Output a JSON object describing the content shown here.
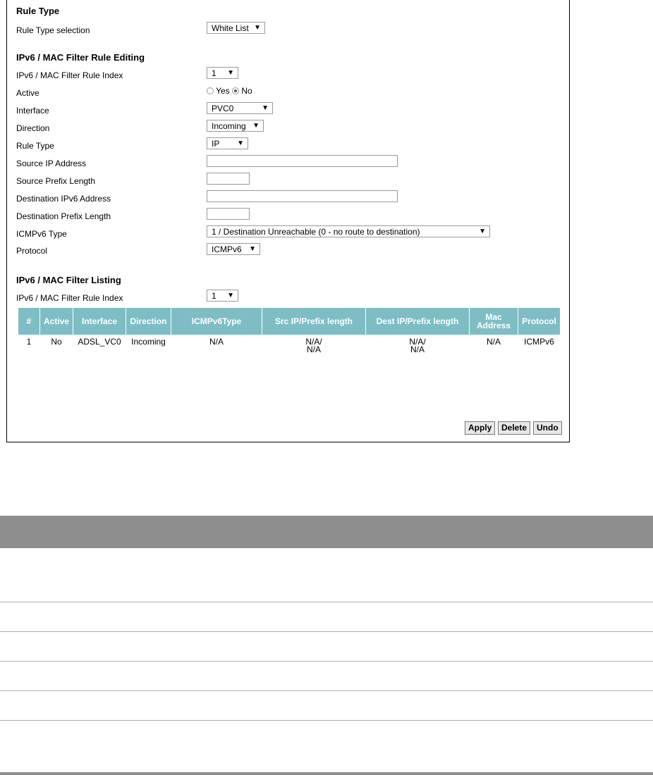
{
  "rule_type_section": {
    "title": "Rule Type",
    "selection_label": "Rule Type selection",
    "selection_value": "White List"
  },
  "editing": {
    "title": "IPv6 / MAC Filter Rule Editing",
    "rule_index_label": "IPv6 / MAC Filter Rule Index",
    "rule_index_value": "1",
    "active_label": "Active",
    "active_yes": "Yes",
    "active_no": "No",
    "interface_label": "Interface",
    "interface_value": "PVC0",
    "direction_label": "Direction",
    "direction_value": "Incoming",
    "rule_type_label": "Rule Type",
    "rule_type_value": "IP",
    "source_ip_label": "Source IP Address",
    "source_ip_value": "",
    "source_prefix_label": "Source Prefix Length",
    "source_prefix_value": "",
    "dest_ip_label": "Destination IPv6 Address",
    "dest_ip_value": "",
    "dest_prefix_label": "Destination Prefix Length",
    "dest_prefix_value": "",
    "icmp_label": "ICMPv6 Type",
    "icmp_value": "1 / Destination Unreachable (0 - no route to destination)",
    "protocol_label": "Protocol",
    "protocol_value": "ICMPv6"
  },
  "listing": {
    "title": "IPv6 / MAC Filter Listing",
    "rule_index_label": "IPv6 / MAC Filter Rule Index",
    "rule_index_value": "1",
    "headers": [
      "#",
      "Active",
      "Interface",
      "Direction",
      "ICMPv6Type",
      "Src IP/Prefix length",
      "Dest IP/Prefix length",
      "Mac Address",
      "Protocol"
    ],
    "rows": [
      {
        "num": "1",
        "active": "No",
        "interface": "ADSL_VC0",
        "direction": "Incoming",
        "icmp": "N/A",
        "src_a": "N/A/",
        "src_b": "N/A",
        "dest_a": "N/A/",
        "dest_b": "N/A",
        "mac": "N/A",
        "protocol": "ICMPv6"
      }
    ]
  },
  "buttons": {
    "apply": "Apply",
    "delete": "Delete",
    "undo": "Undo"
  },
  "icons": {
    "dropdown": "caret-down-icon"
  },
  "colors": {
    "table_header": "#7fbdc4",
    "gray_bar": "#8e8e8e"
  }
}
